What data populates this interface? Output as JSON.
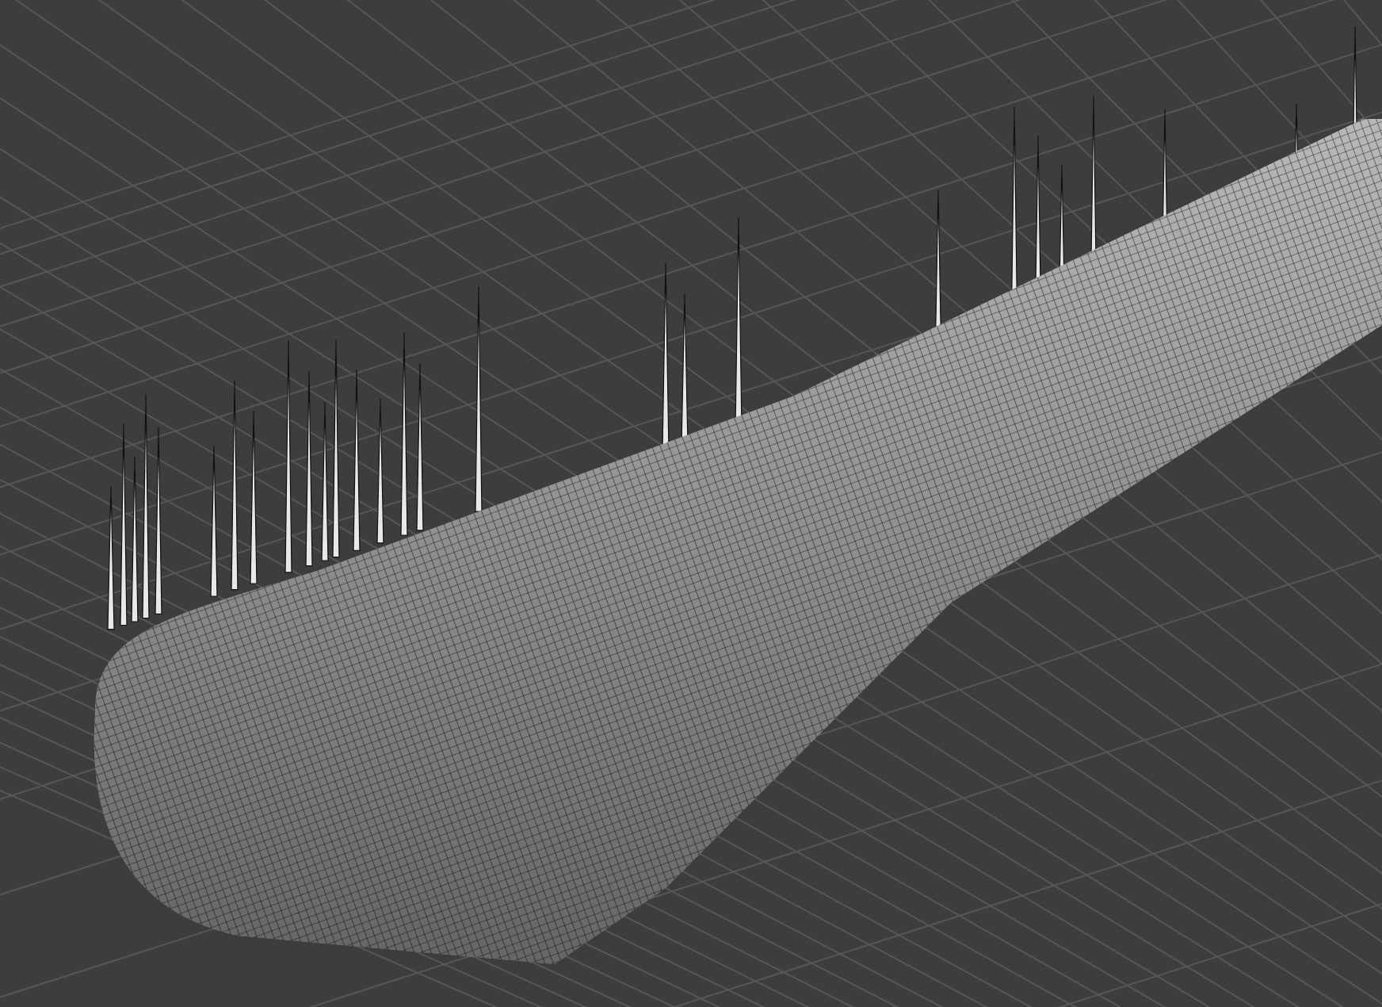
{
  "viewport": {
    "kind": "mesh-view"
  }
}
